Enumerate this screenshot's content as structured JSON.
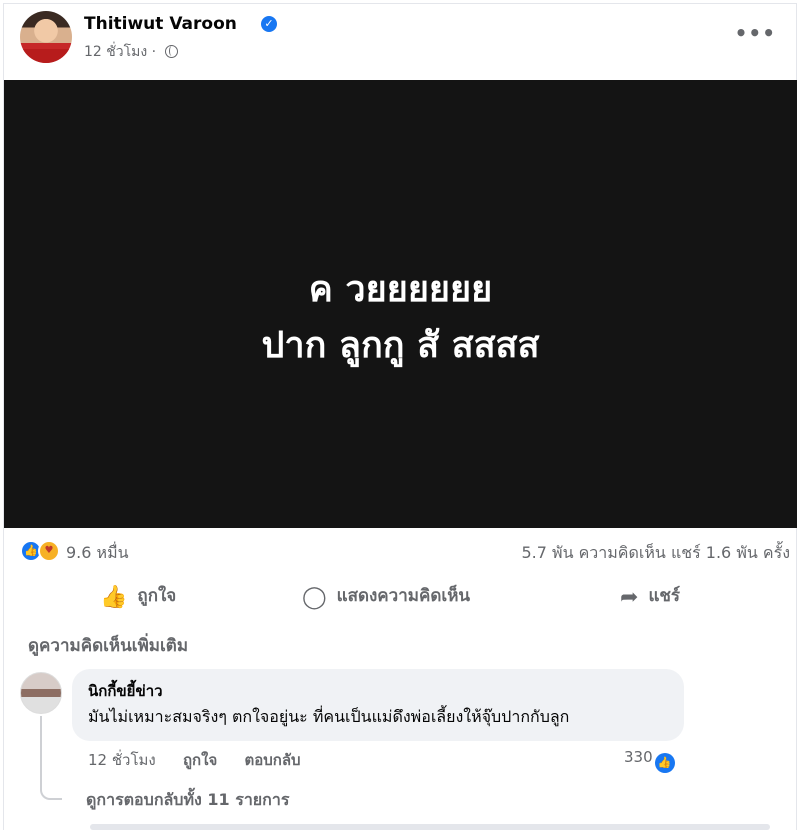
{
  "post": {
    "author": "Thitiwut Varoon",
    "time": "12 ชั่วโมง",
    "separator": "·",
    "more_label": "•••"
  },
  "media": {
    "line1": "ค วยยยยยย",
    "line2": "ปาก ลูกกู สั สสสส"
  },
  "stats": {
    "reaction_count": "9.6 หมื่น",
    "comments_shares": "5.7 พัน ความคิดเห็น  แชร์ 1.6 พัน ครั้ง"
  },
  "actions": {
    "like": "ถูกใจ",
    "comment": "แสดงความคิดเห็น",
    "share": "แชร์"
  },
  "comments": {
    "more_comments": "ดูความคิดเห็นเพิ่มเติม",
    "items": [
      {
        "author": "นิกกี้ขยี้ข่าว",
        "text": "มันไม่เหมาะสมจริงๆ ตกใจอยู่นะ ที่คนเป็นแม่ดึงพ่อเลี้ยงให้จุ๊บปากกับลูก",
        "time": "12 ชั่วโมง",
        "like_label": "ถูกใจ",
        "reply_label": "ตอบกลับ",
        "reaction_count": "330"
      }
    ],
    "view_replies": "ดูการตอบกลับทั้ง 11 รายการ"
  },
  "icons": {
    "verified": "verified-badge-icon",
    "privacy": "globe-icon",
    "like": "thumbs-up-icon",
    "comment": "speech-bubble-icon",
    "share": "share-arrow-icon"
  },
  "colors": {
    "accent": "#1877f2",
    "secondary_text": "#65676b",
    "media_bg": "#141414",
    "comment_bg": "#f0f2f5"
  }
}
